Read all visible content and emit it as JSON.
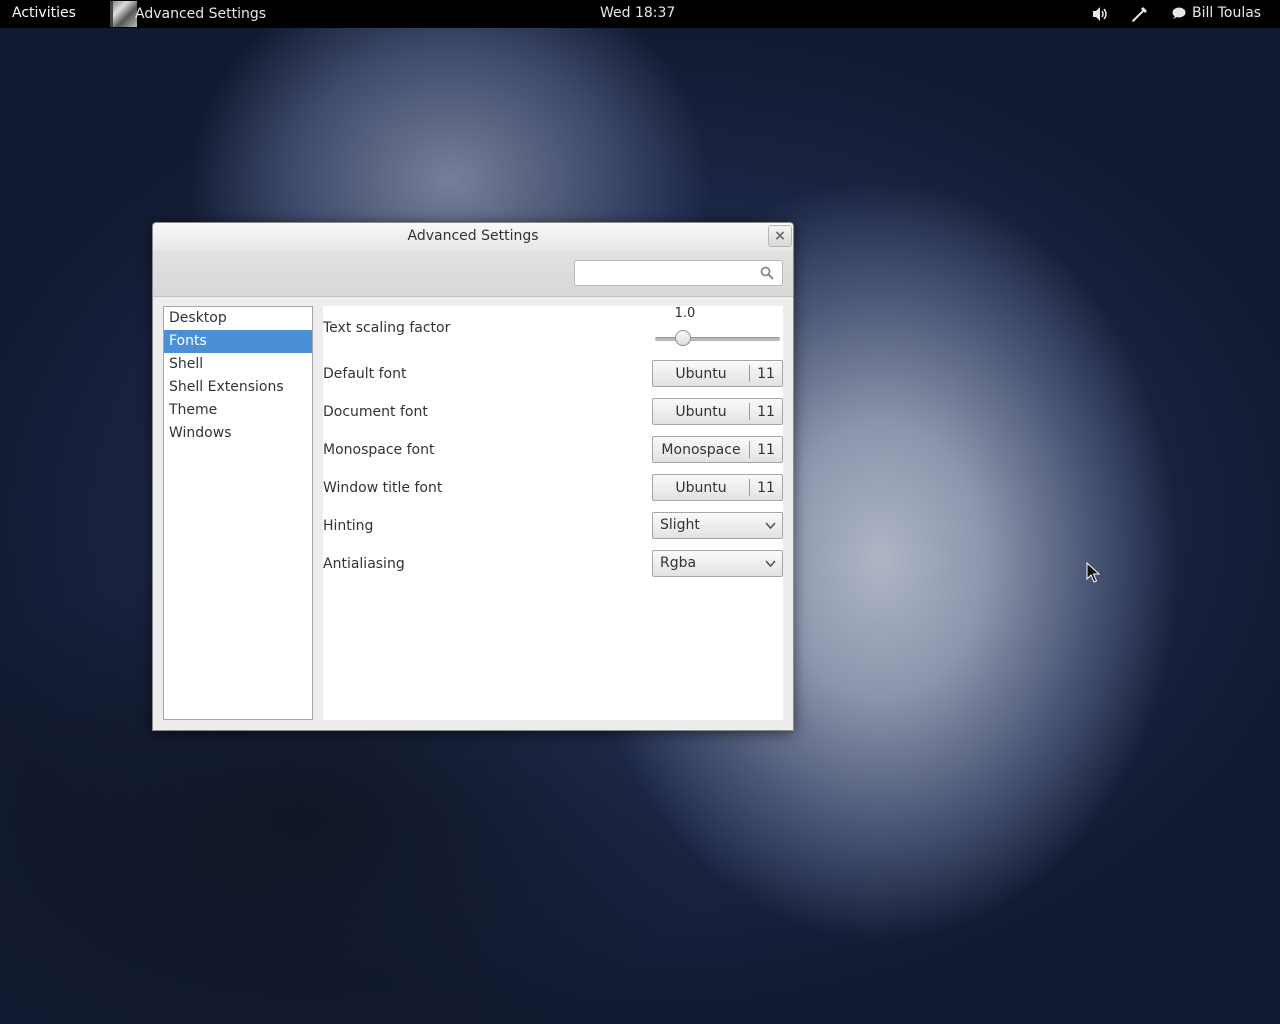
{
  "topbar": {
    "activities": "Activities",
    "app_title": "Advanced Settings",
    "clock": "Wed 18:37",
    "user": "Bill Toulas"
  },
  "window": {
    "title": "Advanced Settings",
    "close_label": "×",
    "search": {
      "value": "",
      "placeholder": ""
    }
  },
  "sidebar": {
    "items": [
      {
        "label": "Desktop"
      },
      {
        "label": "Fonts"
      },
      {
        "label": "Shell"
      },
      {
        "label": "Shell Extensions"
      },
      {
        "label": "Theme"
      },
      {
        "label": "Windows"
      }
    ],
    "selected": "Fonts"
  },
  "fonts": {
    "text_scaling": {
      "label": "Text scaling factor",
      "value": "1.0",
      "slider_fraction": 0.25
    },
    "default_font": {
      "label": "Default font",
      "name": "Ubuntu",
      "size": "11"
    },
    "document_font": {
      "label": "Document font",
      "name": "Ubuntu",
      "size": "11"
    },
    "monospace_font": {
      "label": "Monospace font",
      "name": "Monospace",
      "size": "11"
    },
    "window_title_font": {
      "label": "Window title font",
      "name": "Ubuntu",
      "size": "11"
    },
    "hinting": {
      "label": "Hinting",
      "value": "Slight"
    },
    "antialiasing": {
      "label": "Antialiasing",
      "value": "Rgba"
    }
  },
  "colors": {
    "selection": "#4a90d9",
    "topbar": "#000000"
  },
  "icons": [
    "app-icon",
    "volume-icon",
    "network-icon",
    "chat-icon",
    "search-icon",
    "chevron-down-icon",
    "close-icon",
    "mouse-cursor-icon"
  ]
}
